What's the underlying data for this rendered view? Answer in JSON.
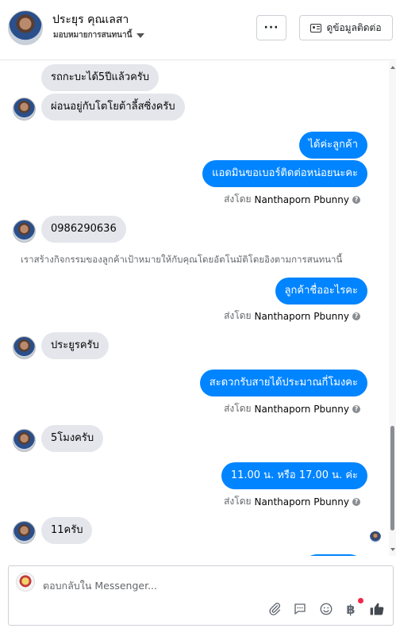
{
  "header": {
    "contact_name": "ประยุร คุณเลสา",
    "assignment": "มอบหมายการสนทนานี้",
    "more_label": "···",
    "contact_info_label": "ดูข้อมูลติดต่อ"
  },
  "messages": [
    {
      "dir": "in",
      "text": "รถกะบะได้5ปีแล้วครับ"
    },
    {
      "dir": "in",
      "text": "ผ่อนอยู่กับโตโยต้าลี้สซิ่งครับ"
    },
    {
      "dir": "out",
      "text": "ได้ค่ะลูกค้า"
    },
    {
      "dir": "out",
      "text": "แอดมินขอเบอร์ติดต่อหน่อยนะคะ"
    },
    {
      "dir": "in",
      "text": "0986290636"
    },
    {
      "dir": "out",
      "text": "ลูกค้าชื่ออะไรคะ"
    },
    {
      "dir": "in",
      "text": "ประยูรครับ"
    },
    {
      "dir": "out",
      "text": "สะดวกรับสายได้ประมาณกี่โมงคะ"
    },
    {
      "dir": "in",
      "text": "5โมงครับ"
    },
    {
      "dir": "out",
      "text": "11.00 น. หรือ 17.00 น. ค่ะ"
    },
    {
      "dir": "in",
      "text": "11ครับ"
    }
  ],
  "sent_by_prefix": "ส่งโดย",
  "sent_by_name": "Nanthaporn Pbunny",
  "system_notice": "เราสร้างกิจกรรมของลูกค้าเป้าหมายให้กับคุณโดยอัตโนมัติโดยอิงตามการสนทนานี้",
  "composer": {
    "placeholder": "ตอบกลับใน Messenger..."
  },
  "icons": [
    "more-icon",
    "contact-card-icon",
    "caret-down-icon",
    "help-icon",
    "attach-icon",
    "saved-replies-icon",
    "emoji-icon",
    "baht-icon",
    "thumbs-up-icon"
  ],
  "colors": {
    "outgoing_bubble": "#0084ff",
    "incoming_bubble": "#e4e6eb",
    "accent": "#1877f2",
    "notification": "#f02849"
  }
}
